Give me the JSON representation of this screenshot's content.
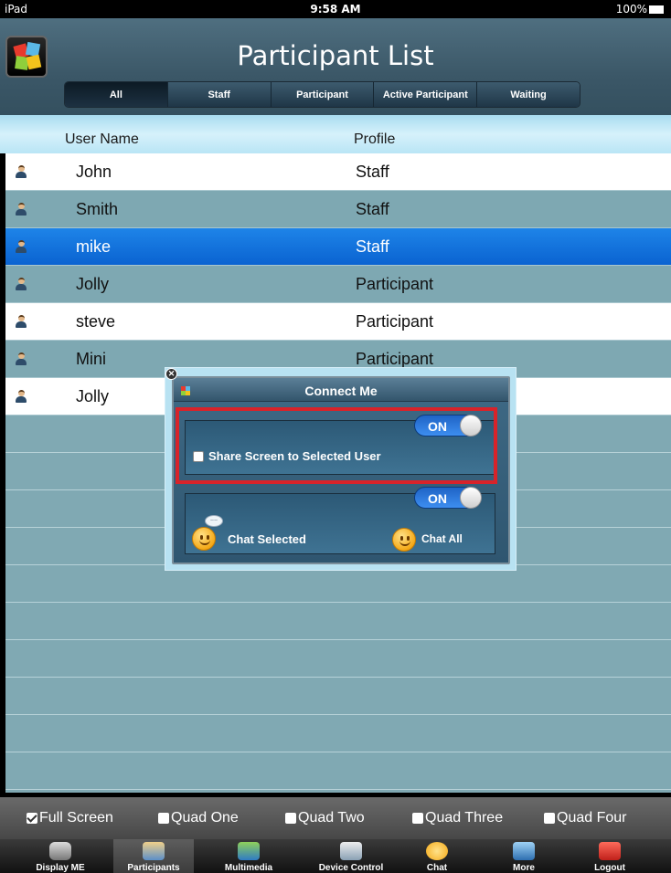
{
  "status": {
    "device": "iPad",
    "time": "9:58 AM",
    "battery": "100%"
  },
  "header": {
    "title": "Participant List",
    "segments": [
      {
        "label": "All",
        "active": true
      },
      {
        "label": "Staff",
        "active": false
      },
      {
        "label": "Participant",
        "active": false
      },
      {
        "label": "Active Participant",
        "active": false
      },
      {
        "label": "Waiting",
        "active": false
      }
    ]
  },
  "table": {
    "columns": {
      "user": "User Name",
      "profile": "Profile"
    },
    "rows": [
      {
        "name": "John",
        "profile": "Staff",
        "style": "white"
      },
      {
        "name": "Smith",
        "profile": "Staff",
        "style": "teal"
      },
      {
        "name": "mike",
        "profile": "Staff",
        "style": "selected"
      },
      {
        "name": "Jolly",
        "profile": "Participant",
        "style": "teal"
      },
      {
        "name": "steve",
        "profile": "Participant",
        "style": "white"
      },
      {
        "name": "Mini",
        "profile": "Participant",
        "style": "teal"
      },
      {
        "name": "Jolly",
        "profile": "",
        "style": "white"
      }
    ]
  },
  "popup": {
    "title": "Connect Me",
    "close_glyph": "✕",
    "toggle1": "ON",
    "share_label": "Share Screen to Selected User",
    "toggle2": "ON",
    "bubble": "~~",
    "chat_selected": "Chat Selected",
    "chat_all": "Chat All"
  },
  "quad": [
    {
      "label": "Full Screen",
      "checked": true
    },
    {
      "label": "Quad One",
      "checked": false
    },
    {
      "label": "Quad Two",
      "checked": false
    },
    {
      "label": "Quad Three",
      "checked": false
    },
    {
      "label": "Quad Four",
      "checked": false
    }
  ],
  "tabs": [
    {
      "label": "Display ME",
      "icon": "camera-icon",
      "active": false
    },
    {
      "label": "Participants",
      "icon": "participants-icon",
      "active": true
    },
    {
      "label": "Multimedia",
      "icon": "multimedia-icon",
      "active": false
    },
    {
      "label": "Device Control",
      "icon": "device-control-icon",
      "active": false
    },
    {
      "label": "Chat",
      "icon": "chat-icon",
      "active": false
    },
    {
      "label": "More",
      "icon": "more-icon",
      "active": false
    },
    {
      "label": "Logout",
      "icon": "logout-icon",
      "active": false
    }
  ],
  "colors": {
    "selected_row": "#1a7ae0",
    "teal_row": "#7ea8b2",
    "highlight_frame": "#d8232a",
    "toggle_on": "#2a7ae0"
  }
}
